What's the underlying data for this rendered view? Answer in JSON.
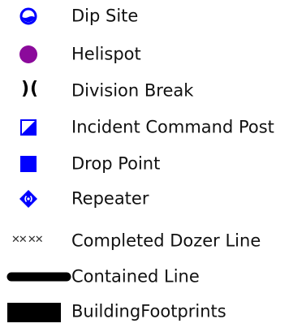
{
  "colors": {
    "blue": "#0000ff",
    "purple": "#8b0a9b",
    "black": "#000000",
    "text": "#111111"
  },
  "legend": {
    "items": [
      {
        "label": "Dip Site",
        "icon": "dip-site-icon"
      },
      {
        "label": "Helispot",
        "icon": "helispot-icon"
      },
      {
        "label": "Division Break",
        "icon": "division-break-icon",
        "glyph": ")("
      },
      {
        "label": "Incident Command Post",
        "icon": "incident-command-post-icon"
      },
      {
        "label": "Drop Point",
        "icon": "drop-point-icon"
      },
      {
        "label": "Repeater",
        "icon": "repeater-icon"
      },
      {
        "label": "Completed Dozer Line",
        "icon": "completed-dozer-line-icon",
        "glyph": "✕✕ ✕✕"
      },
      {
        "label": "Contained Line",
        "icon": "contained-line-icon"
      },
      {
        "label": "BuildingFootprints",
        "icon": "building-footprints-icon"
      }
    ]
  }
}
